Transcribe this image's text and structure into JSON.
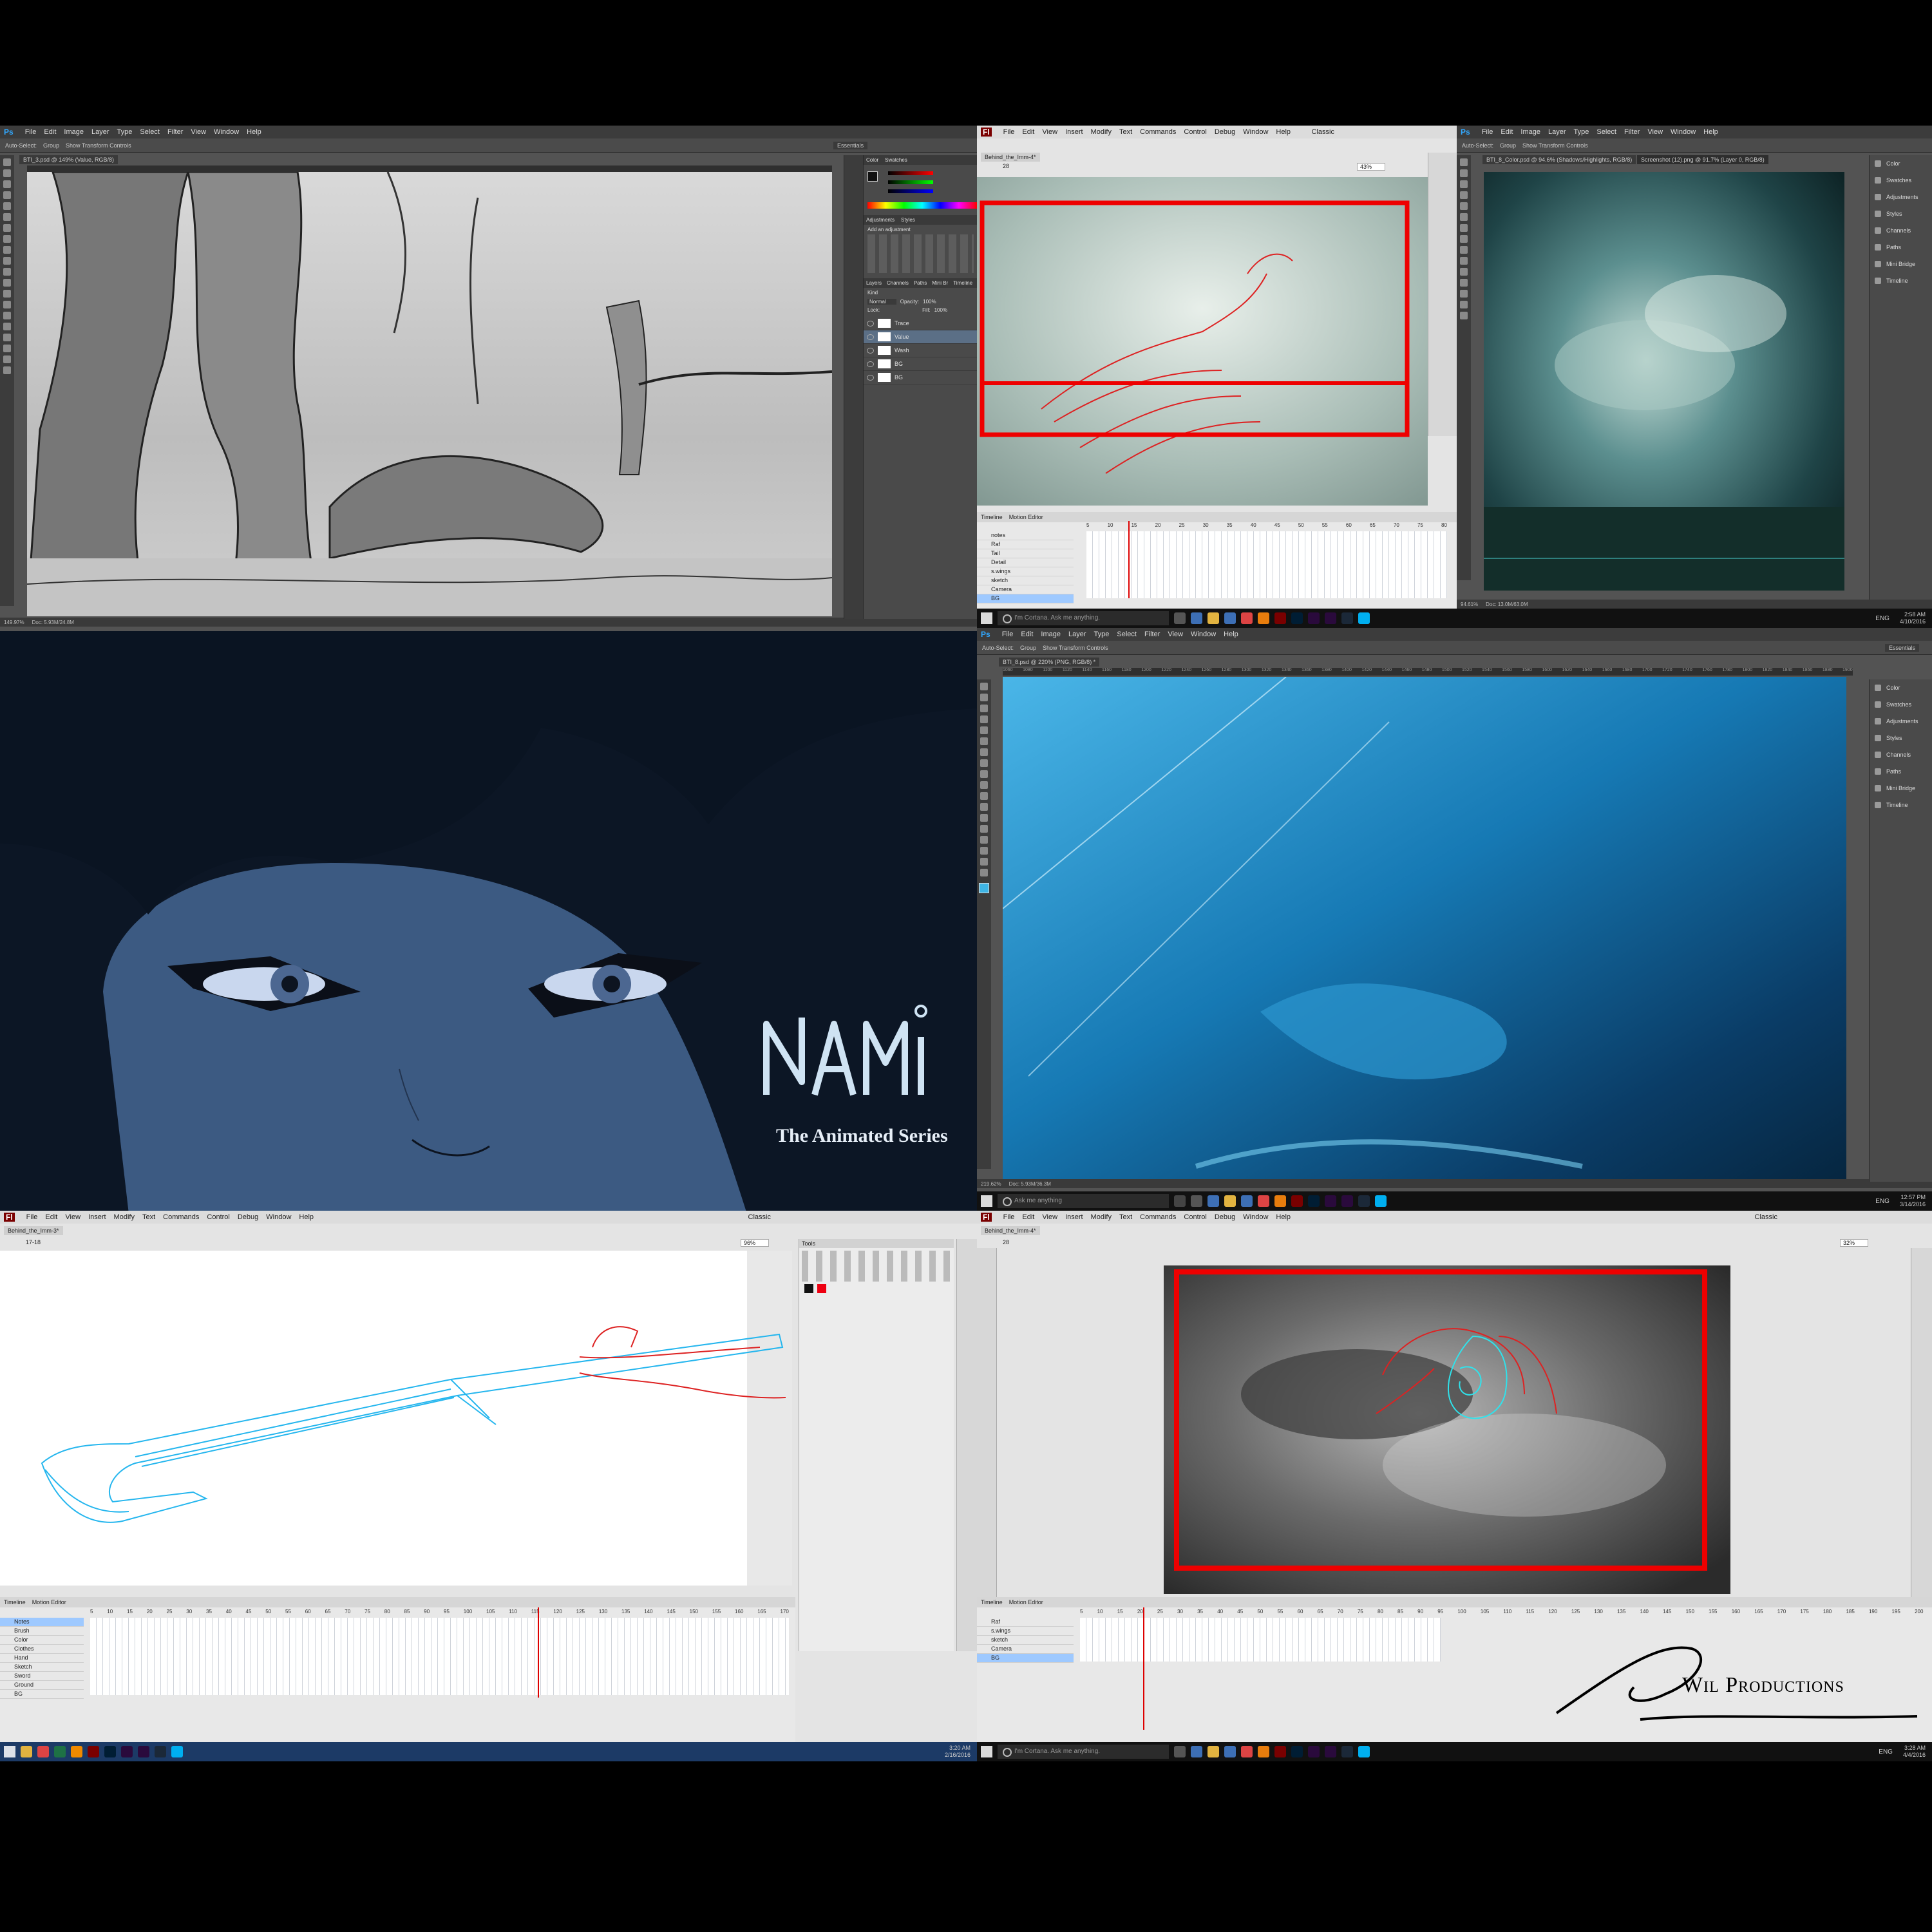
{
  "quad1": {
    "app_logo": "Ps",
    "menu": [
      "File",
      "Edit",
      "Image",
      "Layer",
      "Type",
      "Select",
      "Filter",
      "View",
      "Window",
      "Help"
    ],
    "options": {
      "auto_select": "Auto-Select:",
      "group": "Group",
      "transform": "Show Transform Controls",
      "workspace": "Essentials"
    },
    "doc_tab": "BTI_3.psd @ 149% (Value, RGB/8)",
    "zoom": "149.97%",
    "doc_size": "Doc: 5.93M/24.8M",
    "color_tabs": [
      "Color",
      "Swatches"
    ],
    "adj_tabs": [
      "Adjustments",
      "Styles"
    ],
    "adj_label": "Add an adjustment",
    "layer_tabs": [
      "Layers",
      "Channels",
      "Paths",
      "Mini Br",
      "Timeline"
    ],
    "layer_kind": "Kind",
    "blend_mode": "Normal",
    "opacity_label": "Opacity:",
    "opacity": "100%",
    "lock_label": "Lock:",
    "fill_label": "Fill:",
    "fill": "100%",
    "layers": [
      "Trace",
      "Value",
      "Wash",
      "BG",
      "BG"
    ]
  },
  "quad2": {
    "app_logo": "Fl",
    "menu": [
      "File",
      "Edit",
      "View",
      "Insert",
      "Modify",
      "Text",
      "Commands",
      "Control",
      "Debug",
      "Window",
      "Help"
    ],
    "workspace": "Classic",
    "doc_tab": "Behind_the_Imm-4*",
    "scene": "28",
    "zoom": "43%",
    "timeline_tabs": [
      "Timeline",
      "Motion Editor"
    ],
    "frame_numbers": [
      "5",
      "10",
      "15",
      "20",
      "25",
      "30",
      "35",
      "40",
      "45",
      "50",
      "55",
      "60",
      "65",
      "70",
      "75",
      "80"
    ],
    "layers": [
      "notes",
      "Raf",
      "Tail",
      "Detail",
      "s.wings",
      "sketch",
      "Camera",
      "BG"
    ]
  },
  "quad3": {
    "app_logo": "Ps",
    "menu": [
      "File",
      "Edit",
      "Image",
      "Layer",
      "Type",
      "Select",
      "Filter",
      "View",
      "Window",
      "Help"
    ],
    "auto_select": "Auto-Select:",
    "group": "Group",
    "transform": "Show Transform Controls",
    "doc_tabs": [
      "BTI_8_Color.psd @ 94.6% (Shadows/Highlights, RGB/8)",
      "Screenshot (12).png @ 91.7% (Layer 0, RGB/8)"
    ],
    "zoom": "94.61%",
    "doc_size": "Doc: 13.0M/63.0M",
    "panels": [
      "Color",
      "Swatches",
      "Adjustments",
      "Styles",
      "Channels",
      "Paths",
      "Mini Bridge",
      "Timeline"
    ]
  },
  "quad4": {
    "title": "The Animated Series"
  },
  "quad5": {
    "app_logo": "Ps",
    "menu": [
      "File",
      "Edit",
      "Image",
      "Layer",
      "Type",
      "Select",
      "Filter",
      "View",
      "Window",
      "Help"
    ],
    "auto_select": "Auto-Select:",
    "group": "Group",
    "transform": "Show Transform Controls",
    "workspace": "Essentials",
    "doc_tab": "BTI_8.psd @ 220% (PNG, RGB/8) *",
    "zoom": "219.62%",
    "doc_size": "Doc: 5.93M/36.3M",
    "ruler": [
      "1060",
      "1080",
      "1100",
      "1120",
      "1140",
      "1160",
      "1180",
      "1200",
      "1220",
      "1240",
      "1260",
      "1280",
      "1300",
      "1320",
      "1340",
      "1360",
      "1380",
      "1400",
      "1420",
      "1440",
      "1460",
      "1480",
      "1500",
      "1520",
      "1540",
      "1560",
      "1580",
      "1600",
      "1620",
      "1640",
      "1660",
      "1680",
      "1700",
      "1720",
      "1740",
      "1760",
      "1780",
      "1800",
      "1820",
      "1840",
      "1860",
      "1880",
      "1900"
    ],
    "panels": [
      "Color",
      "Swatches",
      "Adjustments",
      "Styles",
      "Channels",
      "Paths",
      "Mini Bridge",
      "Timeline"
    ]
  },
  "quad6": {
    "app_logo": "Fl",
    "menu": [
      "File",
      "Edit",
      "View",
      "Insert",
      "Modify",
      "Text",
      "Commands",
      "Control",
      "Debug",
      "Window",
      "Help"
    ],
    "workspace": "Classic",
    "doc_tab": "Behind_the_Imm-3*",
    "scene": "17-18",
    "zoom": "96%",
    "tools_label": "Tools",
    "timeline_tabs": [
      "Timeline",
      "Motion Editor"
    ],
    "frame_numbers": [
      "5",
      "10",
      "15",
      "20",
      "25",
      "30",
      "35",
      "40",
      "45",
      "50",
      "55",
      "60",
      "65",
      "70",
      "75",
      "80",
      "85",
      "90",
      "95",
      "100",
      "105",
      "110",
      "115",
      "120",
      "125",
      "130",
      "135",
      "140",
      "145",
      "150",
      "155",
      "160",
      "165",
      "170"
    ],
    "layers": [
      "Notes",
      "Brush",
      "Color",
      "Clothes",
      "Hand",
      "Sketch",
      "Sword",
      "Ground",
      "BG"
    ]
  },
  "quad7": {
    "app_logo": "Fl",
    "menu": [
      "File",
      "Edit",
      "View",
      "Insert",
      "Modify",
      "Text",
      "Commands",
      "Control",
      "Debug",
      "Window",
      "Help"
    ],
    "workspace": "Classic",
    "doc_tab": "Behind_the_Imm-4*",
    "scene": "28",
    "zoom": "32%",
    "timeline_tabs": [
      "Timeline",
      "Motion Editor"
    ],
    "frame_numbers": [
      "5",
      "10",
      "15",
      "20",
      "25",
      "30",
      "35",
      "40",
      "45",
      "50",
      "55",
      "60",
      "65",
      "70",
      "75",
      "80",
      "85",
      "90",
      "95",
      "100",
      "105",
      "110",
      "115",
      "120",
      "125",
      "130",
      "135",
      "140",
      "145",
      "150",
      "155",
      "160",
      "165",
      "170",
      "175",
      "180",
      "185",
      "190",
      "195",
      "200"
    ],
    "layers": [
      "Raf",
      "s.wings",
      "sketch",
      "Camera",
      "BG"
    ],
    "watermark": "Wil Productions"
  },
  "taskbars": {
    "top_right": {
      "search": "I'm Cortana. Ask me anything.",
      "time": "2:58 AM",
      "date": "4/10/2016",
      "lang": "ENG"
    },
    "middle_right": {
      "search": "Ask me anything",
      "time": "12:57 PM",
      "date": "3/14/2016",
      "lang": "ENG"
    },
    "bottom_left": {
      "time": "3:20 AM",
      "date": "2/16/2016"
    },
    "bottom_right": {
      "search": "I'm Cortana. Ask me anything.",
      "time": "3:28 AM",
      "date": "4/4/2016",
      "lang": "ENG"
    }
  }
}
